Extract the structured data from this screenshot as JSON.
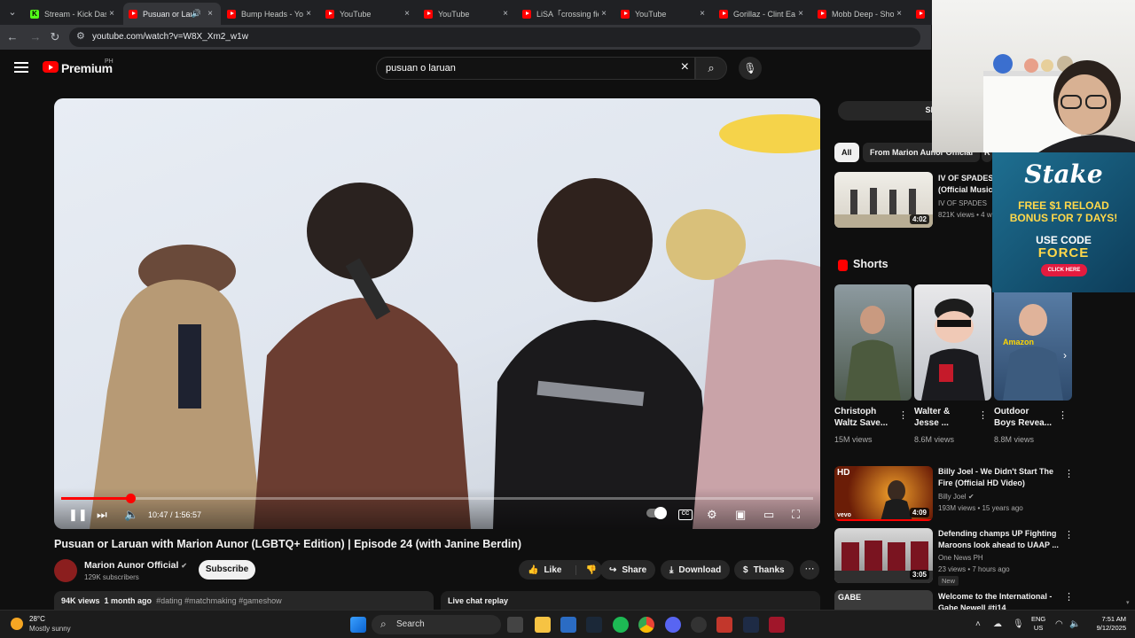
{
  "browser": {
    "tabs": [
      {
        "title": "Stream - Kick Dash",
        "favicon": "kick-icon",
        "active": false
      },
      {
        "title": "Pusuan or Laruan",
        "favicon": "youtube-icon",
        "active": true,
        "audio": true
      },
      {
        "title": "Bump Heads - YouTube",
        "favicon": "youtube-icon",
        "active": false
      },
      {
        "title": "YouTube",
        "favicon": "youtube-icon",
        "active": false
      },
      {
        "title": "YouTube",
        "favicon": "youtube-icon",
        "active": false
      },
      {
        "title": "LiSA「crossing field」",
        "favicon": "youtube-icon",
        "active": false
      },
      {
        "title": "YouTube",
        "favicon": "youtube-icon",
        "active": false
      },
      {
        "title": "Gorillaz - Clint Eastwood",
        "favicon": "youtube-icon",
        "active": false
      },
      {
        "title": "Mobb Deep - Shook Ones",
        "favicon": "youtube-icon",
        "active": false
      },
      {
        "title": "Yo",
        "favicon": "youtube-icon",
        "active": false
      }
    ],
    "url": "youtube.com/watch?v=W8X_Xm2_w1w"
  },
  "youtube": {
    "brand": "Premium",
    "region": "PH",
    "search_query": "pusuan o laruan",
    "accent": "#ff0000"
  },
  "player": {
    "current_time": "10:47",
    "duration": "1:56:57",
    "time_display": "10:47 / 1:56:57",
    "progress_fraction": 0.092
  },
  "video": {
    "title": "Pusuan or Laruan with Marion Aunor (LGBTQ+ Edition) | Episode 24 (with Janine Berdin)",
    "channel": "Marion Aunor Official",
    "subscribers": "129K subscribers",
    "subscribe_label": "Subscribe",
    "like_label": "Like",
    "share_label": "Share",
    "download_label": "Download",
    "thanks_label": "Thanks",
    "views": "94K views",
    "published": "1 month ago",
    "hashtags": "#dating #matchmaking #gameshow",
    "live_chat_label": "Live chat replay"
  },
  "sidebar": {
    "top_button": "Sh",
    "chips": [
      "All",
      "From Marion Aunor Official",
      "R"
    ],
    "first_video": {
      "title_lines": [
        "IV OF SPADES -",
        "(Official Music"
      ],
      "channel": "IV OF SPADES",
      "meta": "821K views • 4 w",
      "duration": "4:02"
    },
    "shorts_heading": "Shorts",
    "shorts": [
      {
        "title_lines": [
          "Christoph",
          "Waltz Save..."
        ],
        "views": "15M views"
      },
      {
        "title_lines": [
          "Walter &",
          "Jesse ..."
        ],
        "views": "8.6M views"
      },
      {
        "title_lines": [
          "Outdoor",
          "Boys Revea..."
        ],
        "views": "8.8M views",
        "thumb_label": "Amazon"
      }
    ],
    "videos": [
      {
        "title_lines": [
          "Billy Joel - We Didn't Start The",
          "Fire (Official HD Video)"
        ],
        "channel": "Billy Joel",
        "meta": "193M views • 15 years ago",
        "duration": "4:09",
        "thumb_label": "HD",
        "thumb_sub": "vevo"
      },
      {
        "title_lines": [
          "Defending champs UP Fighting",
          "Maroons look ahead to UAAP ..."
        ],
        "channel": "One News PH",
        "meta": "23 views • 7 hours ago",
        "duration": "3:05",
        "badge": "New"
      },
      {
        "title_lines": [
          "Welcome to the International -",
          "Gabe Newell #ti14"
        ],
        "thumb_label": "GABE"
      }
    ]
  },
  "ad": {
    "logo": "Stake",
    "line1": "FREE $1 RELOAD",
    "line2": "BONUS FOR 7 DAYS!",
    "line3": "USE CODE",
    "code": "FORCE",
    "button": "CLICK HERE"
  },
  "taskbar": {
    "temperature": "28°C",
    "weather": "Mostly sunny",
    "search_label": "Search",
    "lang_line1": "ENG",
    "lang_line2": "US",
    "time": "7:51 AM",
    "date": "9/12/2025"
  }
}
